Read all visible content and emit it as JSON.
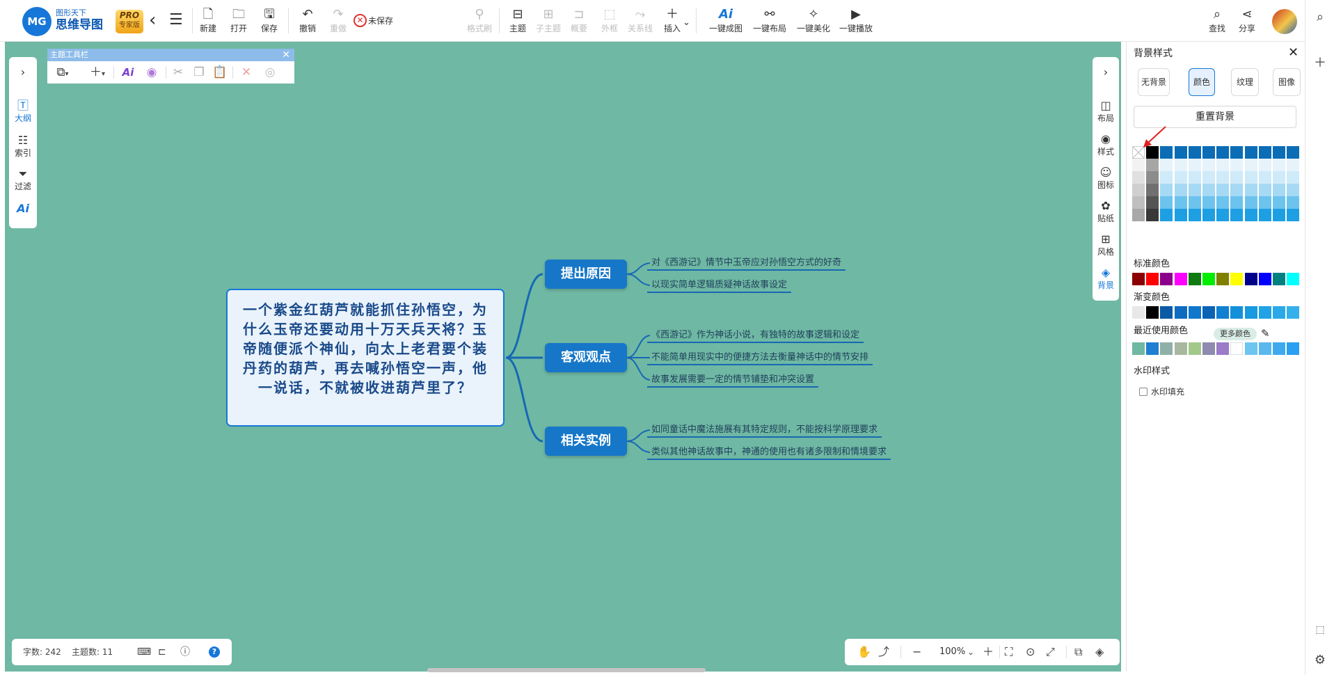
{
  "app": {
    "logo_text": "MG",
    "brand_sub": "图形天下",
    "brand_main": "思维导图",
    "pro_top": "PRO",
    "pro_bottom": "专家版",
    "unsaved": "未保存"
  },
  "toolbar": {
    "new": "新建",
    "open": "打开",
    "save": "保存",
    "undo": "撤销",
    "redo": "重做",
    "format_brush": "格式刷",
    "topic": "主题",
    "subtopic": "子主题",
    "summary": "概要",
    "boundary": "外框",
    "relation": "关系线",
    "insert": "插入",
    "ai_map": "一键成图",
    "auto_layout": "一键布局",
    "beautify": "一键美化",
    "play": "一键播放",
    "find": "查找",
    "share": "分享"
  },
  "left_panel": {
    "outline": "大纲",
    "index": "索引",
    "filter": "过滤",
    "ai": "Ai"
  },
  "topic_toolbar": {
    "title": "主题工具栏"
  },
  "right_tools": {
    "layout": "布局",
    "style": "样式",
    "icon": "图标",
    "sticker": "贴纸",
    "theme": "风格",
    "background": "背景"
  },
  "bg_panel": {
    "title": "背景样式",
    "tabs": [
      "无背景",
      "颜色",
      "纹理",
      "图像"
    ],
    "reset": "重置背景",
    "standard_label": "标准颜色",
    "gradient_label": "渐变颜色",
    "recent_label": "最近使用颜色",
    "more_colors": "更多颜色",
    "watermark_label": "水印样式",
    "watermark_fill": "水印填充",
    "grid_gray_cols": [
      [
        "#ffffff",
        "#f2f2f2",
        "#e0e0e0",
        "#cfcfcf",
        "#bfbfbf",
        "#a8a8a8"
      ],
      [
        "#000000",
        "#a6a6a6",
        "#8c8c8c",
        "#707070",
        "#545454",
        "#383838"
      ]
    ],
    "grid_blue_rows": [
      "#0a6db5",
      "#e6f3fb",
      "#cfeaf8",
      "#a6d9f4",
      "#6cc3ee",
      "#1e9fe3",
      "#0f86cc",
      "#0a6db5"
    ],
    "standard": [
      "#8b0000",
      "#ff0000",
      "#8b008b",
      "#ff00ff",
      "#0f7a0f",
      "#00ee00",
      "#808000",
      "#ffff00",
      "#00008b",
      "#0000ff",
      "#008080",
      "#00ffff"
    ],
    "gradient": [
      "#e8e8e8",
      "#000000",
      "#0a5aa5",
      "#0d6cbf",
      "#1078cc",
      "#0a63b5",
      "#1280d0",
      "#1490da",
      "#1899e0",
      "#20a3e6",
      "#2aa8e8",
      "#36b0ec"
    ],
    "recent": [
      "#6fb8a3",
      "#1e7fd0",
      "#8fb0a8",
      "#a8b8a0",
      "#a2c98a",
      "#8e8ab0",
      "#9a7cc8",
      "#ffffff",
      "#6ec5f0",
      "#5ab8ef",
      "#3fa9f0",
      "#2b9ff0"
    ]
  },
  "status": {
    "word_count": "字数: 242",
    "topic_count": "主题数: 11"
  },
  "zoom": {
    "value": "100%"
  },
  "map": {
    "root": "一个紫金红葫芦就能抓住孙悟空，为什么玉帝还要动用十万天兵天将？玉帝随便派个神仙，向太上老君要个装丹药的葫芦，再去喊孙悟空一声，他一说话，不就被收进葫芦里了？",
    "branches": [
      {
        "title": "提出原因",
        "leaves": [
          "对《西游记》情节中玉帝应对孙悟空方式的好奇",
          "以现实简单逻辑质疑神话故事设定"
        ]
      },
      {
        "title": "客观观点",
        "leaves": [
          "《西游记》作为神话小说，有独特的故事逻辑和设定",
          "不能简单用现实中的便捷方法去衡量神话中的情节安排",
          "故事发展需要一定的情节铺垫和冲突设置"
        ]
      },
      {
        "title": "相关实例",
        "leaves": [
          "如同童话中魔法施展有其特定规则，不能按科学原理要求",
          "类似其他神话故事中，神通的使用也有诸多限制和情境要求"
        ]
      }
    ]
  }
}
